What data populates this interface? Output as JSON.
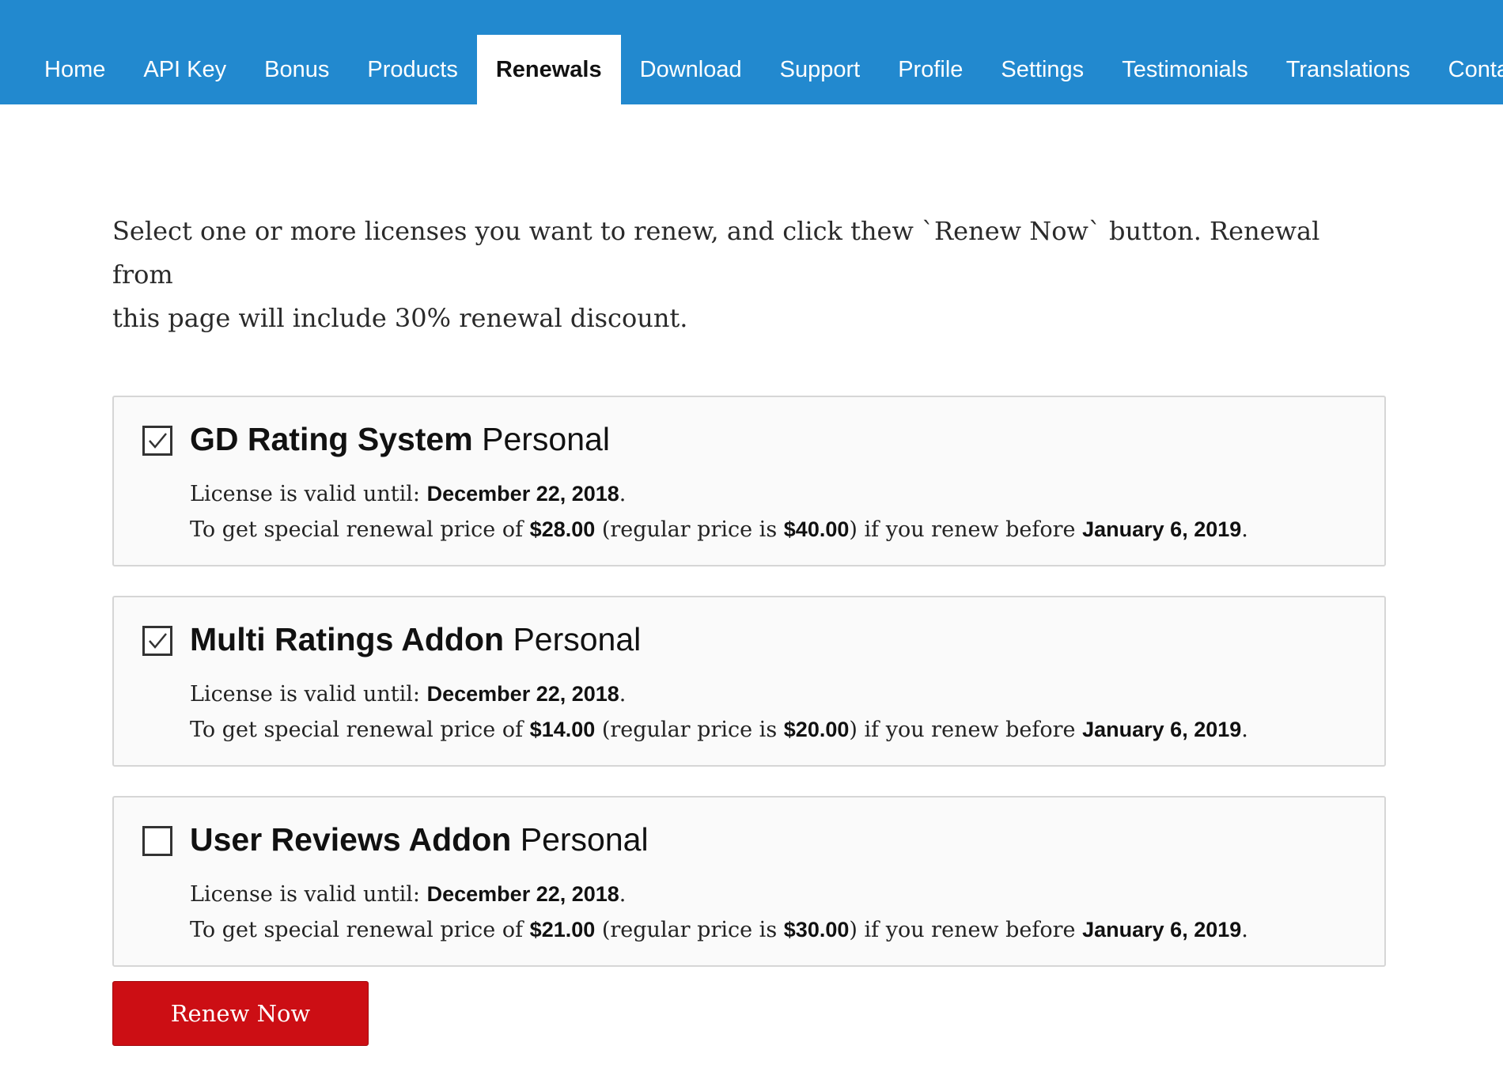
{
  "nav": {
    "items": [
      "Home",
      "API Key",
      "Bonus",
      "Products",
      "Renewals",
      "Download",
      "Support",
      "Profile",
      "Settings",
      "Testimonials",
      "Translations",
      "Contact"
    ],
    "active": "Renewals"
  },
  "intro_line1": "Select one or more licenses you want to renew, and click thew `Renew Now` button. Renewal from",
  "intro_line2": "this page will include 30% renewal discount.",
  "licenses": [
    {
      "name": "GD Rating System",
      "plan": "Personal",
      "checked": true,
      "valid_label": "License is valid until:",
      "valid_until": "December 22, 2018",
      "price_prefix": "To get special renewal price of",
      "special_price": "$28.00",
      "regular_prefix": "(regular price is",
      "regular_price": "$40.00",
      "before_prefix": ") if you renew before",
      "renew_before": "January 6, 2019"
    },
    {
      "name": "Multi Ratings Addon",
      "plan": "Personal",
      "checked": true,
      "valid_label": "License is valid until:",
      "valid_until": "December 22, 2018",
      "price_prefix": "To get special renewal price of",
      "special_price": "$14.00",
      "regular_prefix": "(regular price is",
      "regular_price": "$20.00",
      "before_prefix": ") if you renew before",
      "renew_before": "January 6, 2019"
    },
    {
      "name": "User Reviews Addon",
      "plan": "Personal",
      "checked": false,
      "valid_label": "License is valid until:",
      "valid_until": "December 22, 2018",
      "price_prefix": "To get special renewal price of",
      "special_price": "$21.00",
      "regular_prefix": "(regular price is",
      "regular_price": "$30.00",
      "before_prefix": ") if you renew before",
      "renew_before": "January 6, 2019"
    }
  ],
  "renew_button": "Renew Now",
  "colors": {
    "nav_bg": "#2289cf",
    "button_bg": "#cc0e14"
  }
}
